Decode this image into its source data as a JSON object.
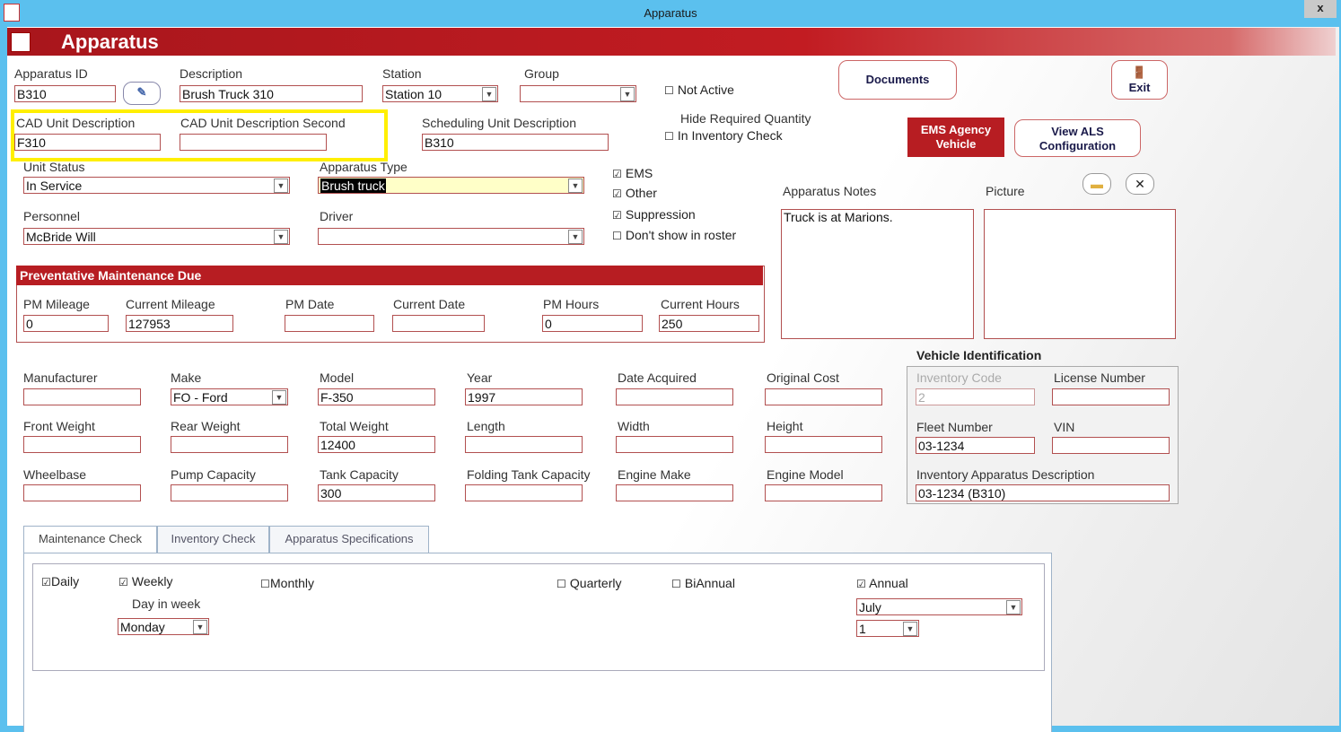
{
  "window": {
    "title": "Apparatus",
    "close": "x"
  },
  "banner": {
    "title": "Apparatus"
  },
  "fields": {
    "apparatus_id": {
      "label": "Apparatus ID",
      "value": "B310"
    },
    "description": {
      "label": "Description",
      "value": "Brush Truck 310"
    },
    "station": {
      "label": "Station",
      "value": "Station 10"
    },
    "group": {
      "label": "Group",
      "value": ""
    },
    "not_active": {
      "label": "Not Active",
      "checked": false
    },
    "cad_unit": {
      "label": "CAD Unit Description",
      "value": "F310"
    },
    "cad_unit_second": {
      "label": "CAD Unit Description Second",
      "value": ""
    },
    "scheduling_unit": {
      "label": "Scheduling Unit Description",
      "value": "B310"
    },
    "hide_req_line1": "Hide Required Quantity",
    "hide_req_line2": "In Inventory Check",
    "unit_status": {
      "label": "Unit Status",
      "value": "In Service"
    },
    "apparatus_type": {
      "label": "Apparatus Type",
      "value": "Brush truck"
    },
    "ems": {
      "label": "EMS",
      "checked": true
    },
    "other": {
      "label": "Other",
      "checked": true
    },
    "suppression": {
      "label": "Suppression",
      "checked": true
    },
    "dont_show": {
      "label": "Don't show in roster",
      "checked": false
    },
    "personnel": {
      "label": "Personnel",
      "value": "McBride  Will"
    },
    "driver": {
      "label": "Driver",
      "value": ""
    },
    "notes": {
      "label": "Apparatus  Notes",
      "value": "Truck is at Marions."
    },
    "picture": {
      "label": "Picture"
    }
  },
  "buttons": {
    "documents": "Documents",
    "exit": "Exit",
    "ems_agency_1": "EMS Agency",
    "ems_agency_2": "Vehicle",
    "view_als_1": "View ALS",
    "view_als_2": "Configuration"
  },
  "pm": {
    "header": "Preventative Maintenance Due",
    "pm_mileage": {
      "label": "PM Mileage",
      "value": "0"
    },
    "current_mileage": {
      "label": "Current Mileage",
      "value": "127953"
    },
    "pm_date": {
      "label": "PM Date",
      "value": ""
    },
    "current_date": {
      "label": "Current Date",
      "value": ""
    },
    "pm_hours": {
      "label": "PM Hours",
      "value": "0"
    },
    "current_hours": {
      "label": "Current Hours",
      "value": "250"
    }
  },
  "specs": {
    "manufacturer": {
      "label": "Manufacturer",
      "value": ""
    },
    "make": {
      "label": "Make",
      "value": "FO - Ford"
    },
    "model": {
      "label": "Model",
      "value": "F-350"
    },
    "year": {
      "label": "Year",
      "value": "1997"
    },
    "date_acquired": {
      "label": "Date Acquired",
      "value": ""
    },
    "original_cost": {
      "label": "Original Cost",
      "value": ""
    },
    "front_weight": {
      "label": "Front Weight",
      "value": ""
    },
    "rear_weight": {
      "label": "Rear Weight",
      "value": ""
    },
    "total_weight": {
      "label": "Total Weight",
      "value": "12400"
    },
    "length": {
      "label": "Length",
      "value": ""
    },
    "width": {
      "label": "Width",
      "value": ""
    },
    "height": {
      "label": "Height",
      "value": ""
    },
    "wheelbase": {
      "label": "Wheelbase",
      "value": ""
    },
    "pump_capacity": {
      "label": "Pump Capacity",
      "value": ""
    },
    "tank_capacity": {
      "label": "Tank Capacity",
      "value": "300"
    },
    "folding_tank": {
      "label": "Folding Tank Capacity",
      "value": ""
    },
    "engine_make": {
      "label": "Engine Make",
      "value": ""
    },
    "engine_model": {
      "label": "Engine Model",
      "value": ""
    }
  },
  "vehicle_id": {
    "title": "Vehicle Identification",
    "inventory_code": {
      "label": "Inventory Code",
      "value": "2"
    },
    "license_number": {
      "label": "License Number",
      "value": ""
    },
    "fleet_number": {
      "label": "Fleet Number",
      "value": "03-1234"
    },
    "vin": {
      "label": "VIN",
      "value": ""
    },
    "inv_desc": {
      "label": "Inventory Apparatus Description",
      "value": "03-1234 (B310)"
    }
  },
  "tabs": [
    "Maintenance  Check",
    "Inventory Check",
    "Apparatus Specifications"
  ],
  "maintenance": {
    "daily": {
      "label": "Daily",
      "checked": true
    },
    "weekly": {
      "label": "Weekly",
      "checked": true
    },
    "monthly": {
      "label": "Monthly",
      "checked": false
    },
    "quarterly": {
      "label": "Quarterly",
      "checked": false
    },
    "biannual": {
      "label": "BiAnnual",
      "checked": false
    },
    "annual": {
      "label": "Annual",
      "checked": true
    },
    "day_in_week_label": "Day in week",
    "day_in_week": "Monday",
    "annual_month": "July",
    "annual_day": "1"
  },
  "colors": {
    "banner": "#b71d22",
    "highlight": "#ffef00",
    "titlebar": "#5bc0ee"
  }
}
